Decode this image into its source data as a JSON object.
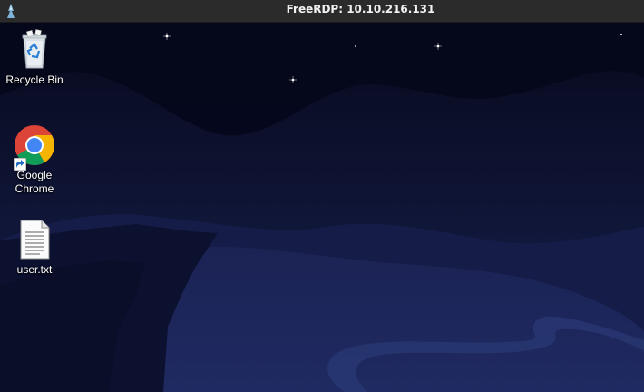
{
  "window": {
    "title": "FreeRDP: 10.10.216.131",
    "app_icon": "freerdp-icon"
  },
  "desktop": {
    "wallpaper": "night-landscape-wallpaper",
    "icons": [
      {
        "name": "recycle-bin",
        "label": "Recycle Bin",
        "icon": "recycle-bin-icon"
      },
      {
        "name": "google-chrome",
        "label": "Google Chrome",
        "icon": "chrome-icon",
        "shortcut": true
      },
      {
        "name": "user-txt",
        "label": "user.txt",
        "icon": "text-file-icon"
      }
    ]
  },
  "colors": {
    "titlebar": "#2b2b2b",
    "sky_top": "#07091c",
    "sky_bottom": "#1a2150",
    "mountain": "#141a44"
  }
}
